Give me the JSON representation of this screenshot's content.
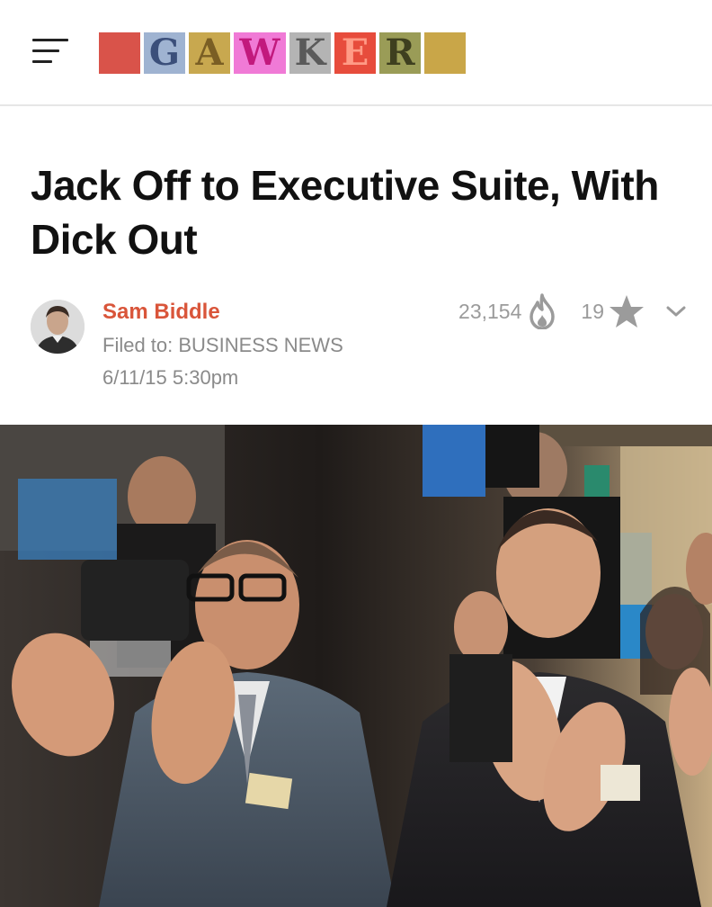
{
  "header": {
    "menu_icon": "hamburger-menu-icon",
    "logo": {
      "tiles": [
        {
          "letter": "",
          "bg": "#d9534a",
          "color": "#d9534a"
        },
        {
          "letter": "G",
          "bg": "#9fb3d1",
          "color": "#3b4f7a"
        },
        {
          "letter": "A",
          "bg": "#c8a84f",
          "color": "#7a5e24"
        },
        {
          "letter": "W",
          "bg": "#f07ad6",
          "color": "#c2197d"
        },
        {
          "letter": "K",
          "bg": "#b4b4b4",
          "color": "#5a5a5a"
        },
        {
          "letter": "E",
          "bg": "#e74c3c",
          "color": "#ff9b86"
        },
        {
          "letter": "R",
          "bg": "#9a9c57",
          "color": "#3e3f1f"
        },
        {
          "letter": "",
          "bg": "#c9a648",
          "color": "#c9a648"
        }
      ]
    }
  },
  "article": {
    "title": "Jack Off to Executive Suite, With Dick Out",
    "author": "Sam Biddle",
    "filed_prefix": "Filed to: ",
    "category": "BUSINESS NEWS",
    "date": "6/11/15 5:30pm",
    "views": "23,154",
    "stars": "19"
  },
  "colors": {
    "author": "#d9553a",
    "meta": "#8a8a8a",
    "stats": "#9b9b9b"
  }
}
